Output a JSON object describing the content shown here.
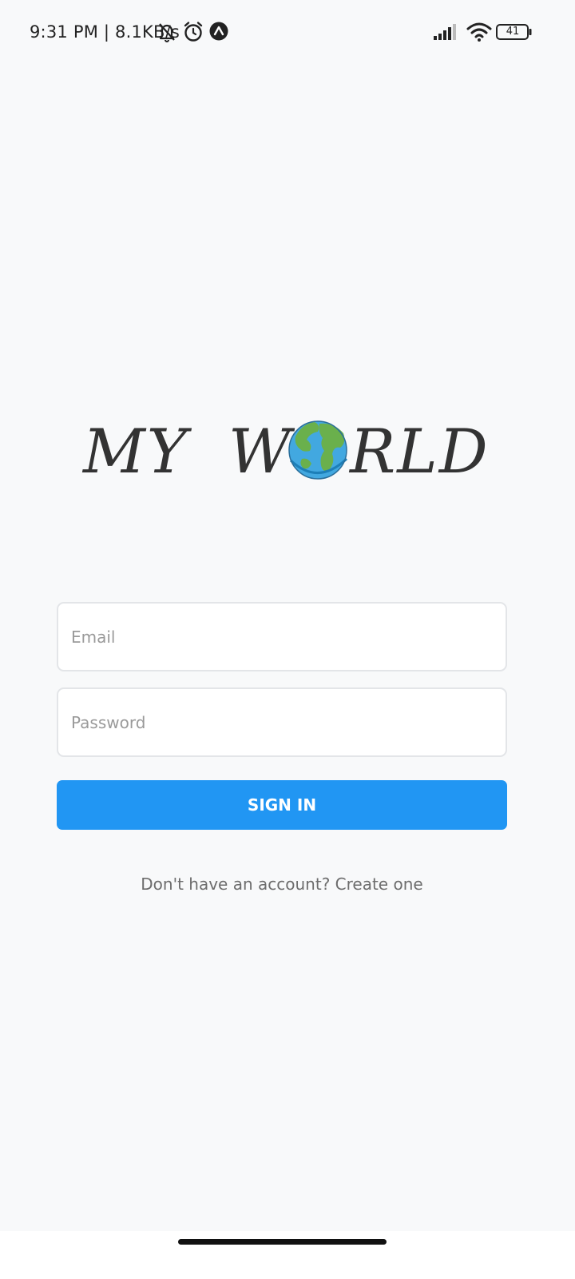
{
  "status_bar": {
    "text": "9:31 PM | 8.1KB/s",
    "battery_level": "41",
    "icons": [
      "bell-off-icon",
      "alarm-icon",
      "a-icon",
      "signal-icon",
      "wifi-icon",
      "battery-icon"
    ]
  },
  "logo": {
    "text_left": "MY",
    "text_w": "W",
    "text_right": "RLD",
    "globe_icon": "earth-globe-icon"
  },
  "form": {
    "email_placeholder": "Email",
    "email_value": "",
    "password_placeholder": "Password",
    "password_value": "",
    "signin_label": "SIGN IN",
    "signup_text": "Don't have an account? Create one"
  },
  "colors": {
    "background": "#f8f9fa",
    "accent": "#2196f3",
    "logo_text": "#333333"
  }
}
